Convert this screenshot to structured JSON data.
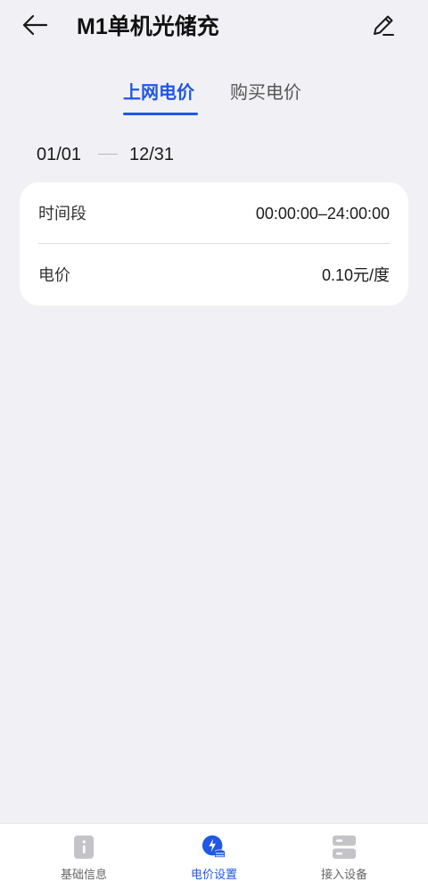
{
  "header": {
    "title": "M1单机光储充",
    "back_icon": "arrow-left-icon",
    "edit_icon": "pencil-icon"
  },
  "tabs": [
    {
      "label": "上网电价",
      "active": true
    },
    {
      "label": "购买电价",
      "active": false
    }
  ],
  "date_range": {
    "start": "01/01",
    "end": "12/31"
  },
  "price_card": {
    "rows": [
      {
        "label": "时间段",
        "value": "00:00:00–24:00:00"
      },
      {
        "label": "电价",
        "value": "0.10元/度"
      }
    ]
  },
  "bottom_nav": {
    "items": [
      {
        "label": "基础信息",
        "icon": "info-doc-icon",
        "active": false
      },
      {
        "label": "电价设置",
        "icon": "electricity-price-icon",
        "active": true
      },
      {
        "label": "接入设备",
        "icon": "device-stack-icon",
        "active": false
      }
    ]
  },
  "colors": {
    "accent": "#1f57e6",
    "background": "#f1f1f5",
    "card": "#ffffff",
    "inactive_icon": "#c4c4c8"
  }
}
